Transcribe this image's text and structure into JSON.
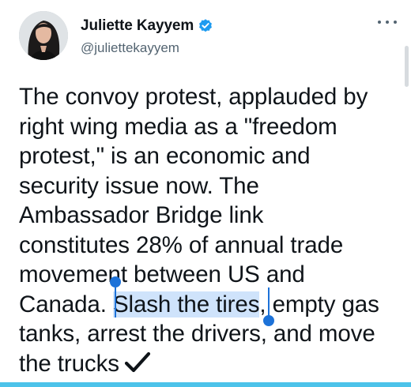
{
  "author": {
    "display_name": "Juliette Kayyem",
    "handle": "@juliettekayyem",
    "verified": true
  },
  "icons": {
    "verified": "verified-badge-icon",
    "more": "more-options-icon",
    "checkmark": "heavy-check-mark-icon"
  },
  "colors": {
    "verified_badge": "#1d9bf0",
    "selection_highlight": "#cfe3fb",
    "selection_handle": "#1d72d8",
    "bottom_accent": "#4cc3ea"
  },
  "tweet": {
    "lines": [
      "The convoy protest, applauded by",
      "right wing media as a \"freedom",
      "protest,\" is an economic and",
      "security issue now. The",
      "Ambassador Bridge link",
      "constitutes 28% of annual trade",
      "movement between US and"
    ],
    "line8_before": "Canada. ",
    "selected_text": "Slash the tires",
    "line8_after": ", empty gas",
    "line9": "tanks, arrest the drivers, and move",
    "line10": "the trucks"
  }
}
